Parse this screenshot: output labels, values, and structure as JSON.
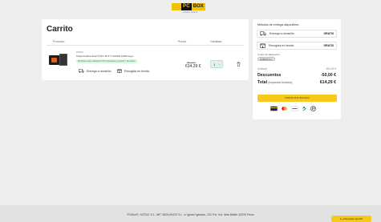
{
  "header": {
    "logo_text_1": "PC",
    "logo_text_2": "BOX",
    "logo_tagline": "power users",
    "brand_color": "#f2c200"
  },
  "cart": {
    "title": "Carrito",
    "columns": {
      "product": "Producto",
      "price": "Precio",
      "quantity": "Cantidad"
    },
    "item": {
      "brand": "ZOTAC",
      "name": "Tarjeta Gráfica Zotac® RTX 4070 TI SUPER 16GB Negro",
      "availability": "Recíbelo entre mañana 07/10 (miércoles) y jueves 7 de marzo",
      "old_price": "684,29 €",
      "price": "614,29 €",
      "quantity": "1",
      "delivery_home_label": "Entrega a domicilio",
      "pickup_label": "Recogida en tienda"
    }
  },
  "summary": {
    "title": "Métodos de entrega disponibles:",
    "options": [
      {
        "label": "Entrega a domicilio",
        "cost": "GRATIS",
        "icon": "truck-icon"
      },
      {
        "label": "Recogida en tienda",
        "cost": "GRATIS",
        "icon": "store-icon"
      }
    ],
    "coupon_label": "Cupón de descuento",
    "coupon_code": "PCBOX70",
    "subtotal_label": "Subtotal",
    "subtotal_value": "684,29 €",
    "discount_label": "Descuentos",
    "discount_value": "-50,00 €",
    "total_label": "Total",
    "total_note": "(impuestos incluidos)",
    "total_value": "614,29 €",
    "checkout_label": "TERMINAR PEDIDO",
    "payment_icons": [
      "card-icon",
      "mastercard-icon",
      "bank-icon",
      "bizum-icon",
      "paypal-icon"
    ]
  },
  "footer": {
    "text": "PCBox®, SOTAC S.L. NIF: B53149419 S.L. c/ Ignasi Iglesias, 101 Pol. Ind. Mas Battle 43200 Reus",
    "help_label": "¿Necesitas ayuda?"
  }
}
